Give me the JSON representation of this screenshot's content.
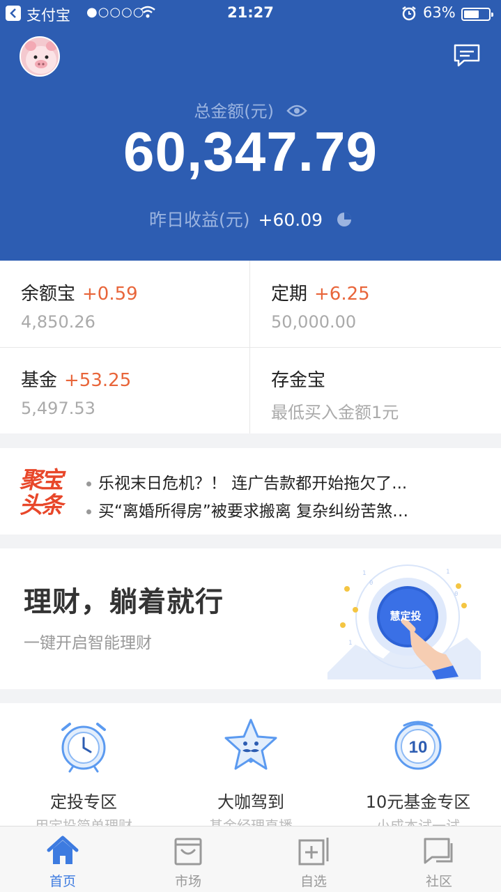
{
  "status_bar": {
    "carrier": "支付宝",
    "signal": "●○○○○",
    "time": "21:27",
    "battery_pct": "63%",
    "battery_level": 0.63
  },
  "summary": {
    "total_label": "总金额(元)",
    "total_amount": "60,347.79",
    "yesterday_label": "昨日收益(元)",
    "yesterday_value": "+60.09"
  },
  "assets": [
    {
      "name": "余额宝",
      "gain": "+0.59",
      "sub": "4,850.26"
    },
    {
      "name": "定期",
      "gain": "+6.25",
      "sub": "50,000.00"
    },
    {
      "name": "基金",
      "gain": "+53.25",
      "sub": "5,497.53"
    },
    {
      "name": "存金宝",
      "gain": "",
      "sub": "最低买入金额1元"
    }
  ],
  "news": {
    "logo_line1": "聚宝",
    "logo_line2": "头条",
    "items": [
      "乐视末日危机？！ 连广告款都开始拖欠了...",
      "买“离婚所得房”被要求搬离 复杂纠纷苦煞…"
    ]
  },
  "banner": {
    "title": "理财，躺着就行",
    "subtitle": "一键开启智能理财",
    "button_label": "慧定投"
  },
  "features": [
    {
      "name": "定投专区",
      "sub": "用定投简单理财",
      "icon": "alarm-clock-icon"
    },
    {
      "name": "大咖驾到",
      "sub": "基金经理直播",
      "icon": "star-mustache-icon"
    },
    {
      "name": "10元基金专区",
      "sub": "小成本试一试",
      "icon": "coin-10-icon"
    }
  ],
  "tabbar": {
    "tabs": [
      {
        "label": "首页",
        "icon": "home-icon",
        "active": true
      },
      {
        "label": "市场",
        "icon": "market-icon",
        "active": false
      },
      {
        "label": "自选",
        "icon": "watchlist-icon",
        "active": false
      },
      {
        "label": "社区",
        "icon": "community-icon",
        "active": false
      }
    ]
  },
  "colors": {
    "header_bg": "#2d5db2",
    "gain": "#e8653a",
    "active_tab": "#3d7be0"
  }
}
